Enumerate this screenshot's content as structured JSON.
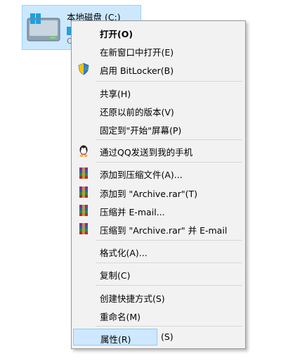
{
  "drive": {
    "label": "本地磁盘 (C:)",
    "partial_text": "C"
  },
  "menu": {
    "items": [
      {
        "label": "打开(O)",
        "bold": true
      },
      {
        "label": "在新窗口中打开(E)"
      },
      {
        "label": "启用 BitLocker(B)",
        "icon": "shield-icon"
      },
      {
        "label": "共享(H)"
      },
      {
        "label": "还原以前的版本(V)"
      },
      {
        "label": "固定到\"开始\"屏幕(P)"
      },
      {
        "label": "通过QQ发送到我的手机",
        "icon": "qq-penguin-icon"
      },
      {
        "label": "添加到压缩文件(A)...",
        "icon": "winrar-icon"
      },
      {
        "label": "添加到 \"Archive.rar\"(T)",
        "icon": "winrar-icon"
      },
      {
        "label": "压缩并 E-mail...",
        "icon": "winrar-icon"
      },
      {
        "label": "压缩到 \"Archive.rar\" 并 E-mail",
        "icon": "winrar-icon"
      },
      {
        "label": "格式化(A)..."
      },
      {
        "label": "复制(C)"
      },
      {
        "label": "创建快捷方式(S)"
      },
      {
        "label": "重命名(M)"
      },
      {
        "label": "属性(R)",
        "highlighted": true
      }
    ],
    "trailing_shortcut": "(S)"
  },
  "colors": {
    "highlight": "#cde8ff",
    "drive_selected": "#cce8ff"
  }
}
